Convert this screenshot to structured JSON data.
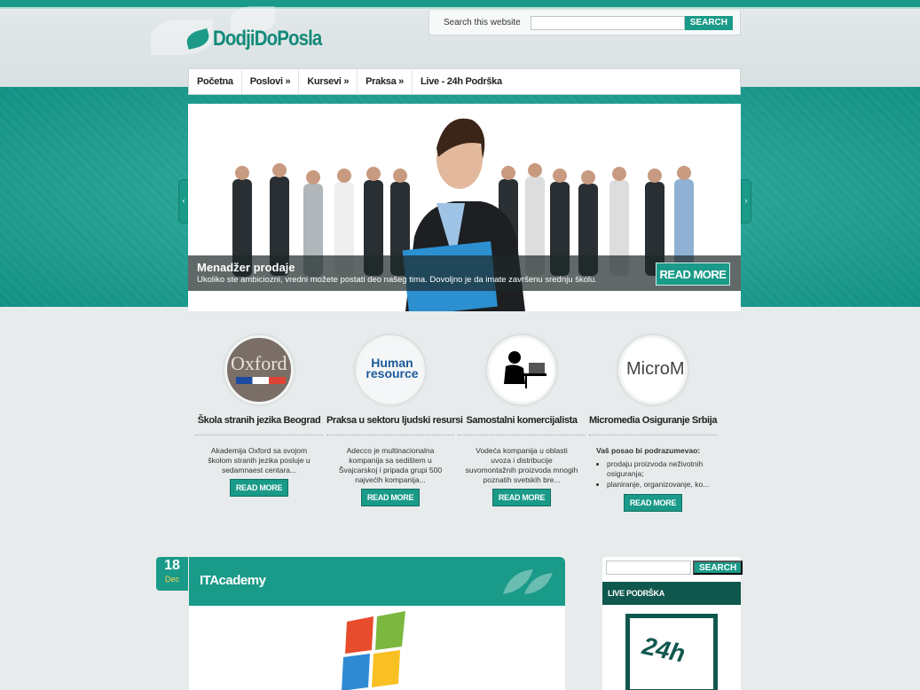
{
  "header": {
    "logo_text": "DodjiDoPosla",
    "search_label": "Search this website",
    "search_button": "SEARCH"
  },
  "nav": {
    "items": [
      {
        "label": "Početna"
      },
      {
        "label": "Poslovi »"
      },
      {
        "label": "Kursevi »"
      },
      {
        "label": "Praksa »"
      },
      {
        "label": "Live - 24h Podrška"
      }
    ]
  },
  "slider": {
    "title": "Menadžer prodaje",
    "text": "Ukoliko ste ambiciozni, vredni možete postati deo našeg tima. Dovoljno je da imate završenu srednju školu.",
    "button": "READ MORE"
  },
  "features": [
    {
      "title": "Škola stranih jezika Beograd",
      "text": "Akademija Oxford sa svojom školom stranih jezika posluje u sedamnaest centara...",
      "button": "READ MORE",
      "image_text": "Oxford"
    },
    {
      "title": "Praksa u sektoru ljudski resursi",
      "text": "Adecco je multinacionalna kompanija sa sedištem u Švajcarskoj i pripada grupi 500 najvećih kompanija...",
      "button": "READ MORE",
      "image_text": "Human resource"
    },
    {
      "title": "Samostalni komercijalista",
      "text": "Vodeća kompanija u oblasti uvoza i distribucije suvomontažnih proizvoda mnogih poznatih svetskih bre...",
      "button": "READ MORE",
      "image_text": ""
    },
    {
      "title": "Micromedia Osiguranje Srbija",
      "intro": "Vaš posao bi podrazumevao:",
      "list": [
        "prodaju proizvoda neživotnih osiguranja;",
        "planiranje, organizovanje, ko..."
      ],
      "button": "READ MORE",
      "image_text": "MicroM"
    }
  ],
  "post": {
    "day": "18",
    "month": "Dec",
    "title": "ITAcademy"
  },
  "sidebar": {
    "search_button": "SEARCH",
    "live_title": "LIVE PODRŠKA",
    "badge_text": "24h"
  },
  "colors": {
    "brand": "#1a9a88",
    "brand_dark": "#10574d"
  }
}
